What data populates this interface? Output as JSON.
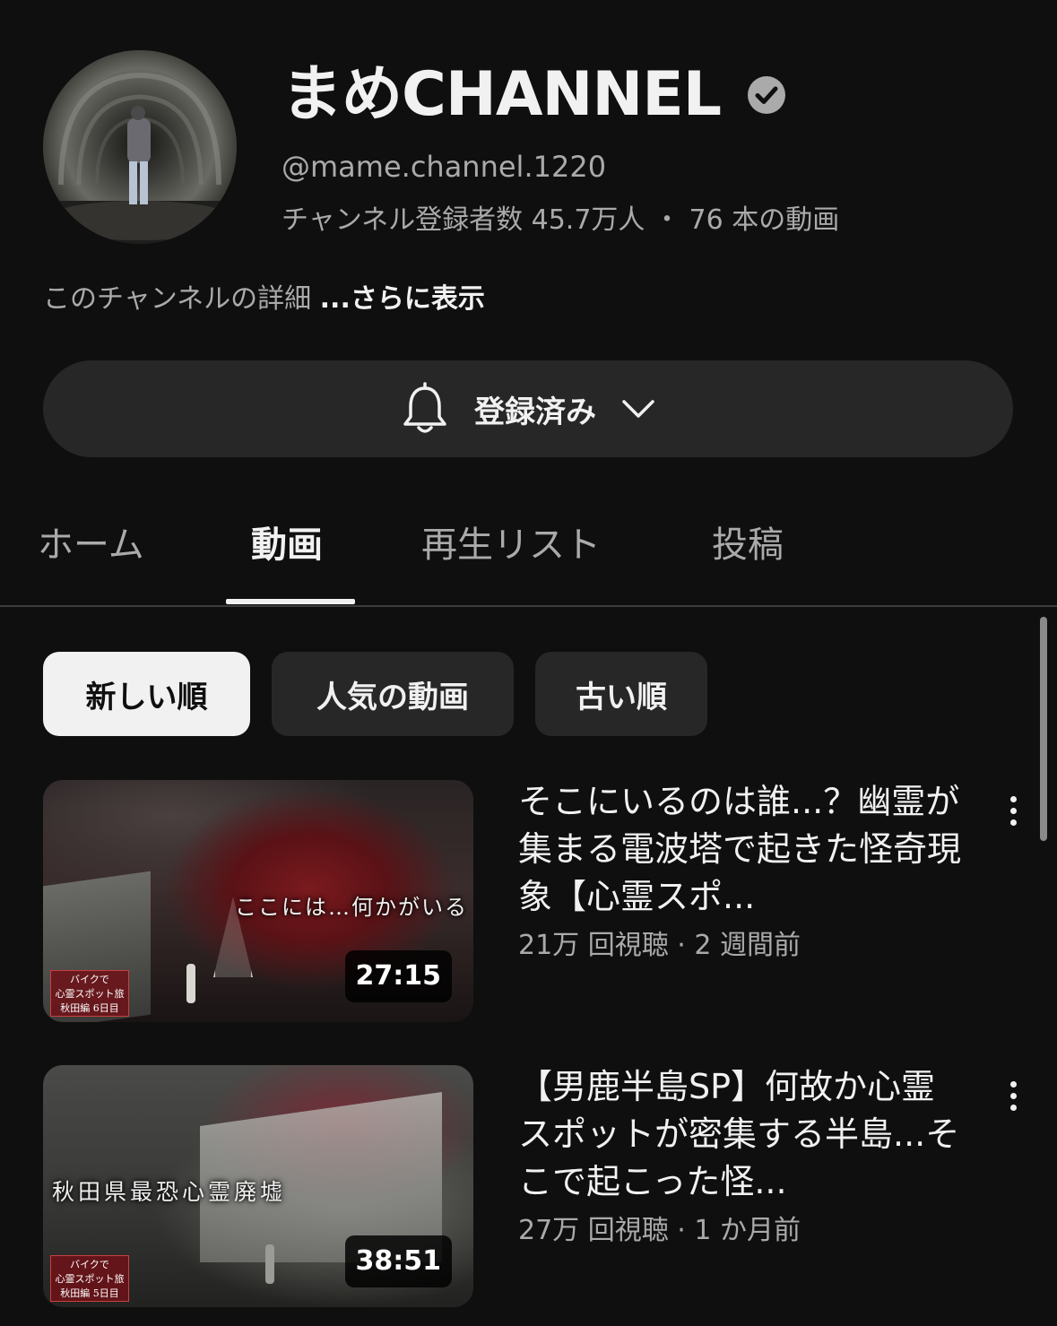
{
  "channel": {
    "name": "まめCHANNEL",
    "handle": "@mame.channel.1220",
    "stats": "チャンネル登録者数 45.7万人 ・ 76 本の動画",
    "description": "このチャンネルの詳細",
    "more_label": "...さらに表示",
    "verified_icon": "verified-check-icon"
  },
  "subscribe": {
    "label": "登録済み",
    "bell_icon": "bell-icon",
    "chevron_icon": "chevron-down-icon"
  },
  "tabs": [
    {
      "label": "ホーム",
      "active": false
    },
    {
      "label": "動画",
      "active": true
    },
    {
      "label": "再生リスト",
      "active": false
    },
    {
      "label": "投稿",
      "active": false
    }
  ],
  "filters": [
    {
      "label": "新しい順",
      "active": true
    },
    {
      "label": "人気の動画",
      "active": false
    },
    {
      "label": "古い順",
      "active": false
    }
  ],
  "videos": [
    {
      "title": "そこにいるのは誰...？幽霊が集まる電波塔で起きた怪奇現象【心霊スポ...",
      "meta": "21万 回視聴 · 2 週間前",
      "duration": "27:15",
      "overlay_text": "ここには…何かがいる",
      "series_tag": [
        "バイクで",
        "心霊スポット旅",
        "秋田編 6日目"
      ]
    },
    {
      "title": "【男鹿半島SP】何故か心霊スポットが密集する半島...そこで起こった怪...",
      "meta": "27万 回視聴 · 1 か月前",
      "duration": "38:51",
      "overlay_text": "秋田県最恐心霊廃墟",
      "series_tag": [
        "バイクで",
        "心霊スポット旅",
        "秋田編 5日目"
      ]
    }
  ],
  "colors": {
    "background": "#0f0f0f",
    "surface": "#272727",
    "text_primary": "#f1f1f1",
    "text_secondary": "#aaaaaa"
  }
}
